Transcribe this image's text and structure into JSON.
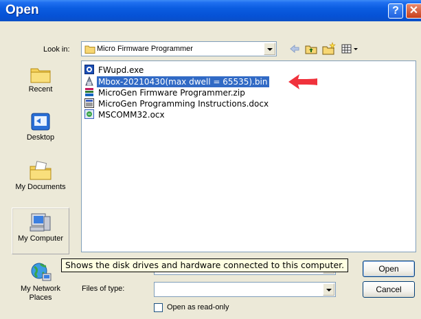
{
  "window": {
    "title": "Open"
  },
  "look_in": {
    "label": "Look in:",
    "value": "Micro Firmware Programmer"
  },
  "places": [
    {
      "label": "Recent"
    },
    {
      "label": "Desktop"
    },
    {
      "label": "My Documents"
    },
    {
      "label": "My Computer"
    },
    {
      "label": "My Network Places"
    }
  ],
  "files": [
    {
      "name": "FWupd.exe",
      "icon": "exe-icon"
    },
    {
      "name": "Mbox-20210430(max dwell = 65535).bin",
      "icon": "bin-file-icon",
      "selected": true
    },
    {
      "name": "MicroGen Firmware Programmer.zip",
      "icon": "zip-icon"
    },
    {
      "name": "MicroGen Programming Instructions.docx",
      "icon": "docx-icon"
    },
    {
      "name": "MSCOMM32.ocx",
      "icon": "ocx-icon"
    }
  ],
  "tooltip": "Shows the disk drives and hardware connected to this computer.",
  "file_name": {
    "value": ""
  },
  "files_of_type": {
    "label": "Files of type:",
    "value": ""
  },
  "buttons": {
    "open": "Open",
    "cancel": "Cancel"
  },
  "readonly": {
    "label": "Open as read-only"
  },
  "colors": {
    "titlebar": "#0a5ce0",
    "selection": "#316ac5",
    "annotation_arrow": "#f0323c"
  }
}
